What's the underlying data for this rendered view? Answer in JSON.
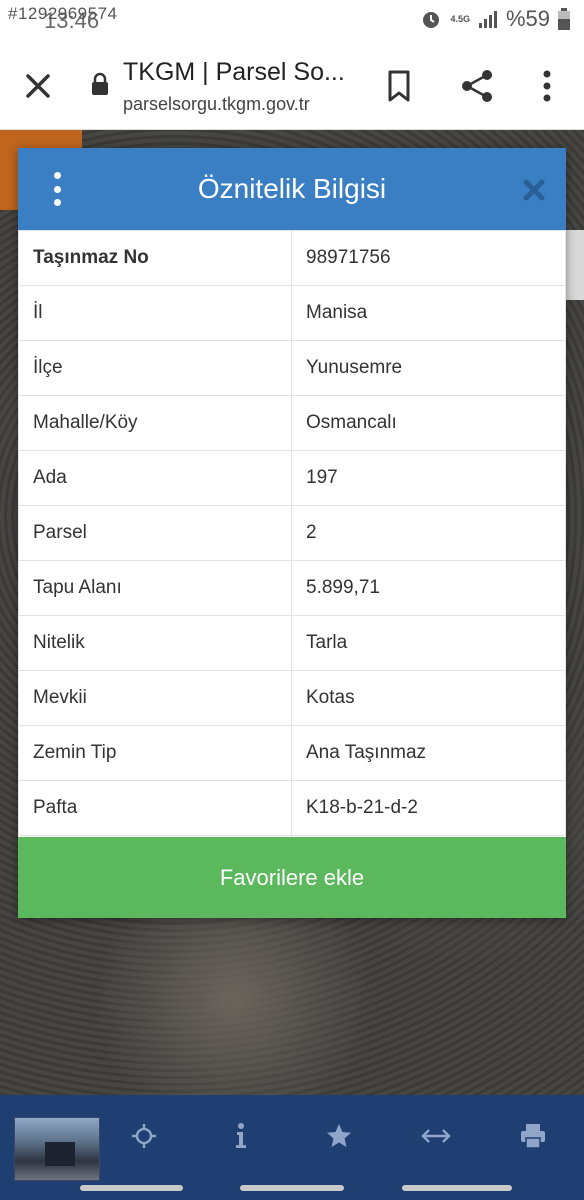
{
  "status_bar": {
    "watermark": "#1292969574",
    "time": "13:46",
    "network": "4.5G",
    "battery": "%59"
  },
  "browser": {
    "title": "TKGM | Parsel So...",
    "url": "parselsorgu.tkgm.gov.tr",
    "icons": [
      "close-icon",
      "lock-icon",
      "bookmark-icon",
      "share-icon",
      "more-vert-icon"
    ]
  },
  "modal": {
    "title": "Öznitelik Bilgisi",
    "rows": [
      {
        "key": "Taşınmaz No",
        "value": "98971756"
      },
      {
        "key": "İl",
        "value": "Manisa"
      },
      {
        "key": "İlçe",
        "value": "Yunusemre"
      },
      {
        "key": "Mahalle/Köy",
        "value": "Osmancalı"
      },
      {
        "key": "Ada",
        "value": "197"
      },
      {
        "key": "Parsel",
        "value": "2"
      },
      {
        "key": "Tapu Alanı",
        "value": "5.899,71"
      },
      {
        "key": "Nitelik",
        "value": "Tarla"
      },
      {
        "key": "Mevkii",
        "value": "Kotas"
      },
      {
        "key": "Zemin Tip",
        "value": "Ana Taşınmaz"
      },
      {
        "key": "Pafta",
        "value": "K18-b-21-d-2"
      }
    ],
    "favorite_button": "Favorilere ekle"
  },
  "colors": {
    "header_blue": "#3a7fc4",
    "button_green": "#5cb85c",
    "toolbar_navy": "#1f3f73"
  },
  "bottom_toolbar": {
    "icons": [
      "crosshair-icon",
      "info-icon",
      "star-icon",
      "measure-icon",
      "print-icon"
    ]
  }
}
